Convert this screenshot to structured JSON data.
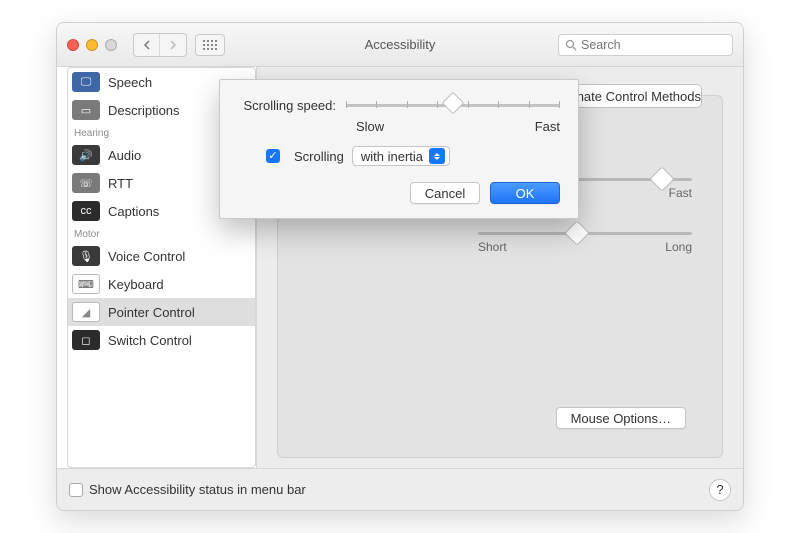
{
  "window": {
    "title": "Accessibility"
  },
  "toolbar": {
    "search_placeholder": "Search"
  },
  "sidebar": {
    "header_hearing": "Hearing",
    "header_motor": "Motor",
    "items": {
      "speech": "Speech",
      "descriptions": "Descriptions",
      "audio": "Audio",
      "rtt": "RTT",
      "captions": "Captions",
      "voice_control": "Voice Control",
      "keyboard": "Keyboard",
      "pointer_control": "Pointer Control",
      "switch_control": "Switch Control"
    }
  },
  "main": {
    "tab_right": "Alternate Control Methods",
    "mouse_options": "Mouse Options…",
    "bg_slider1": {
      "right": "Fast",
      "knobPercent": 82
    },
    "bg_slider2": {
      "left": "Short",
      "right": "Long",
      "knobPercent": 42
    }
  },
  "sheet": {
    "scroll_speed_label": "Scrolling speed:",
    "slow": "Slow",
    "fast": "Fast",
    "scroll_knob_percent": 50,
    "scrolling_checkbox_label": "Scrolling",
    "scrolling_select_value": "with inertia",
    "cancel": "Cancel",
    "ok": "OK"
  },
  "footer": {
    "status_label": "Show Accessibility status in menu bar",
    "help": "?"
  },
  "colors": {
    "red": "#ff5f57",
    "yellow": "#febc2e",
    "green": "#c8c8c8"
  }
}
